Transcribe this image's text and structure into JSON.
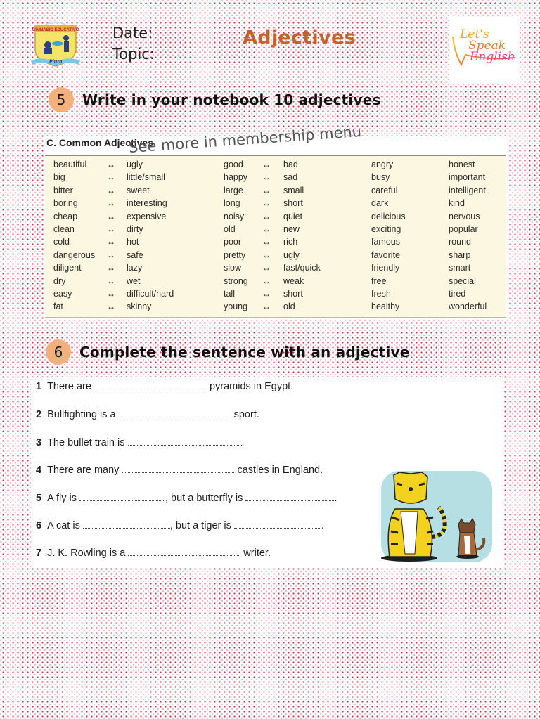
{
  "header": {
    "school_logo": {
      "icon": "school-crest-logo",
      "text_top": "GIMNASIO EDUCATIVO",
      "text_bottom": "Piura"
    },
    "date_label": "Date:",
    "topic_label": "Topic:",
    "title": "Adjectives",
    "brand_logo": {
      "icon": "speech-bubble-logo",
      "line1": "Let's",
      "line2": "Speak",
      "line3": "English"
    }
  },
  "section5": {
    "number": "5",
    "title": "Write in your notebook 10 adjectives"
  },
  "adjectives_table": {
    "heading": "C. Common Adjectives",
    "watermark": "See more in membership menu",
    "opposites_left": [
      {
        "word": "beautiful",
        "opposite": "ugly"
      },
      {
        "word": "big",
        "opposite": "little/small"
      },
      {
        "word": "bitter",
        "opposite": "sweet"
      },
      {
        "word": "boring",
        "opposite": "interesting"
      },
      {
        "word": "cheap",
        "opposite": "expensive"
      },
      {
        "word": "clean",
        "opposite": "dirty"
      },
      {
        "word": "cold",
        "opposite": "hot"
      },
      {
        "word": "dangerous",
        "opposite": "safe"
      },
      {
        "word": "diligent",
        "opposite": "lazy"
      },
      {
        "word": "dry",
        "opposite": "wet"
      },
      {
        "word": "easy",
        "opposite": "difficult/hard"
      },
      {
        "word": "fat",
        "opposite": "skinny"
      }
    ],
    "opposites_right": [
      {
        "word": "good",
        "opposite": "bad"
      },
      {
        "word": "happy",
        "opposite": "sad"
      },
      {
        "word": "large",
        "opposite": "small"
      },
      {
        "word": "long",
        "opposite": "short"
      },
      {
        "word": "noisy",
        "opposite": "quiet"
      },
      {
        "word": "old",
        "opposite": "new"
      },
      {
        "word": "poor",
        "opposite": "rich"
      },
      {
        "word": "pretty",
        "opposite": "ugly"
      },
      {
        "word": "slow",
        "opposite": "fast/quick"
      },
      {
        "word": "strong",
        "opposite": "weak"
      },
      {
        "word": "tall",
        "opposite": "short"
      },
      {
        "word": "young",
        "opposite": "old"
      }
    ],
    "arrow_symbol": "↔",
    "list_a": [
      "angry",
      "busy",
      "careful",
      "dark",
      "delicious",
      "exciting",
      "famous",
      "favorite",
      "friendly",
      "free",
      "fresh",
      "healthy"
    ],
    "list_b": [
      "honest",
      "important",
      "intelligent",
      "kind",
      "nervous",
      "popular",
      "round",
      "sharp",
      "smart",
      "special",
      "tired",
      "wonderful"
    ]
  },
  "section6": {
    "number": "6",
    "title": "Complete the sentence with an adjective",
    "sentences": [
      {
        "n": "1",
        "before": "There are",
        "after": "pyramids in Egypt."
      },
      {
        "n": "2",
        "before": "Bullfighting is a",
        "after": "sport."
      },
      {
        "n": "3",
        "before": "The bullet train is",
        "after": "."
      },
      {
        "n": "4",
        "before": "There are many",
        "after": "castles in England."
      },
      {
        "n": "5",
        "before": "A fly is",
        "middle": ", but a butterfly is",
        "after": "."
      },
      {
        "n": "6",
        "before": "A cat is",
        "middle": ", but a tiger is",
        "after": "."
      },
      {
        "n": "7",
        "before": "J. K. Rowling is a",
        "after": "writer."
      }
    ],
    "illustration": "tiger-and-cat-illustration"
  }
}
